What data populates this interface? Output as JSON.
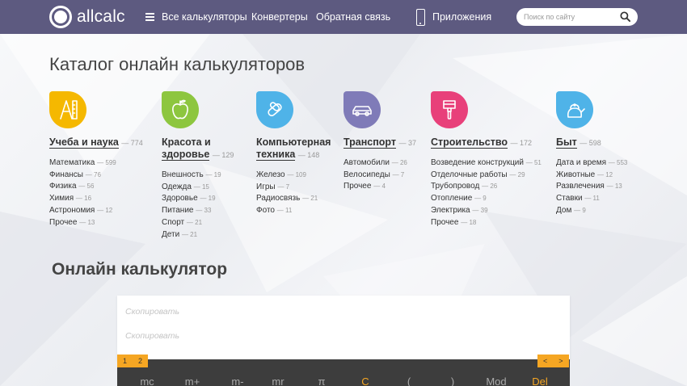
{
  "header": {
    "logo_text": "allcalc",
    "nav_all": "Все калькуляторы",
    "nav_converters": "Конвертеры",
    "nav_feedback": "Обратная связь",
    "nav_apps": "Приложения",
    "search_placeholder": "Поиск по сайту",
    "bg_color": "#5d5a80"
  },
  "catalog": {
    "title": "Каталог онлайн калькуляторов",
    "categories": [
      {
        "title": "Учеба и наука",
        "count": "— 774",
        "color": "#f5b800",
        "icon": "ruler-compass-icon",
        "items": [
          {
            "label": "Математика",
            "count": "— 599"
          },
          {
            "label": "Финансы",
            "count": "— 76"
          },
          {
            "label": "Физика",
            "count": "— 56"
          },
          {
            "label": "Химия",
            "count": "— 16"
          },
          {
            "label": "Астрономия",
            "count": "— 12"
          },
          {
            "label": "Прочее",
            "count": "— 13"
          }
        ]
      },
      {
        "title_line1": "Красота и",
        "title_line2": "здоровье",
        "count": "— 129",
        "color": "#8dc63f",
        "icon": "apple-icon",
        "items": [
          {
            "label": "Внешность",
            "count": "— 19"
          },
          {
            "label": "Одежда",
            "count": "— 15"
          },
          {
            "label": "Здоровье",
            "count": "— 19"
          },
          {
            "label": "Питание",
            "count": "— 33"
          },
          {
            "label": "Спорт",
            "count": "— 21"
          },
          {
            "label": "Дети",
            "count": "— 21"
          }
        ]
      },
      {
        "title_line1": "Компьютерная",
        "title_line2": "техника",
        "count": "— 148",
        "color": "#4fb3e8",
        "icon": "chip-icon",
        "items": [
          {
            "label": "Железо",
            "count": "— 109"
          },
          {
            "label": "Игры",
            "count": "— 7"
          },
          {
            "label": "Радиосвязь",
            "count": "— 21"
          },
          {
            "label": "Фото",
            "count": "— 11"
          }
        ]
      },
      {
        "title": "Транспорт",
        "count": "— 37",
        "color": "#7f7bb8",
        "icon": "car-icon",
        "items": [
          {
            "label": "Автомобили",
            "count": "— 26"
          },
          {
            "label": "Велосипеды",
            "count": "— 7"
          },
          {
            "label": "Прочее",
            "count": "— 4"
          }
        ]
      },
      {
        "title": "Строительство",
        "count": "— 172",
        "color": "#e8407a",
        "icon": "paint-brush-icon",
        "items": [
          {
            "label": "Возведение конструкций",
            "count": "— 51"
          },
          {
            "label": "Отделочные работы",
            "count": "— 29"
          },
          {
            "label": "Трубопровод",
            "count": "— 26"
          },
          {
            "label": "Отопление",
            "count": "— 9"
          },
          {
            "label": "Электрика",
            "count": "— 39"
          },
          {
            "label": "Прочее",
            "count": "— 18"
          }
        ]
      },
      {
        "title": "Быт",
        "count": "— 598",
        "color": "#4fb3e8",
        "icon": "kettle-icon",
        "items": [
          {
            "label": "Дата и время",
            "count": "— 553"
          },
          {
            "label": "Животные",
            "count": "— 12"
          },
          {
            "label": "Развлечения",
            "count": "— 13"
          },
          {
            "label": "Ставки",
            "count": "— 11"
          },
          {
            "label": "Дом",
            "count": "— 9"
          }
        ]
      }
    ]
  },
  "calculator": {
    "title": "Онлайн калькулятор",
    "copy1": "Скопировать",
    "copy2": "Скопировать",
    "mem_tabs": [
      "1",
      "2"
    ],
    "nav_tabs": [
      "<",
      ">"
    ],
    "keys": [
      "mc",
      "m+",
      "m-",
      "mr",
      "π",
      "C",
      "(",
      ")",
      "Mod",
      "Del"
    ],
    "accent": "#f5a623"
  }
}
